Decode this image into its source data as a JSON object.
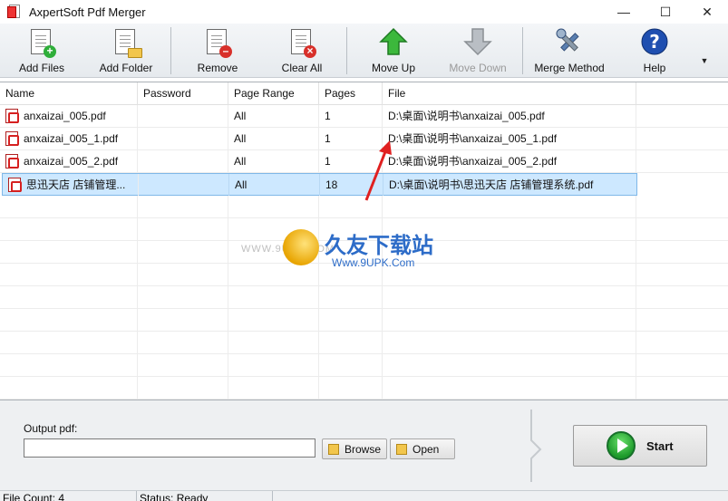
{
  "window": {
    "title": "AxpertSoft Pdf Merger",
    "controls": {
      "minimize": "—",
      "maximize": "☐",
      "close": "✕"
    }
  },
  "toolbar": {
    "add_files": "Add Files",
    "add_folder": "Add Folder",
    "remove": "Remove",
    "clear_all": "Clear All",
    "move_up": "Move Up",
    "move_down": "Move Down",
    "merge_method": "Merge Method",
    "help": "Help",
    "more": "▼"
  },
  "table": {
    "columns": [
      "Name",
      "Password",
      "Page Range",
      "Pages",
      "File"
    ],
    "rows": [
      {
        "name": "anxaizai_005.pdf",
        "password": "",
        "page_range": "All",
        "pages": "1",
        "file": "D:\\桌面\\说明书\\anxaizai_005.pdf"
      },
      {
        "name": "anxaizai_005_1.pdf",
        "password": "",
        "page_range": "All",
        "pages": "1",
        "file": "D:\\桌面\\说明书\\anxaizai_005_1.pdf"
      },
      {
        "name": "anxaizai_005_2.pdf",
        "password": "",
        "page_range": "All",
        "pages": "1",
        "file": "D:\\桌面\\说明书\\anxaizai_005_2.pdf"
      },
      {
        "name": "思迅天店 店铺管理...",
        "password": "",
        "page_range": "All",
        "pages": "18",
        "file": "D:\\桌面\\说明书\\思迅天店 店铺管理系统.pdf",
        "selected": true
      }
    ]
  },
  "watermark": {
    "brand": "久友下载站",
    "url": "Www.9UPK.Com",
    "left_text": "WWW.9UPK.COM"
  },
  "output": {
    "label": "Output pdf:",
    "value": "",
    "browse": "Browse",
    "open": "Open",
    "start": "Start"
  },
  "status": {
    "file_count": "File Count: 4",
    "status": "Status: Ready"
  },
  "colors": {
    "selected_row": "#cde8ff",
    "start_green": "#1d9a2b",
    "arrow_red": "#e02020"
  }
}
